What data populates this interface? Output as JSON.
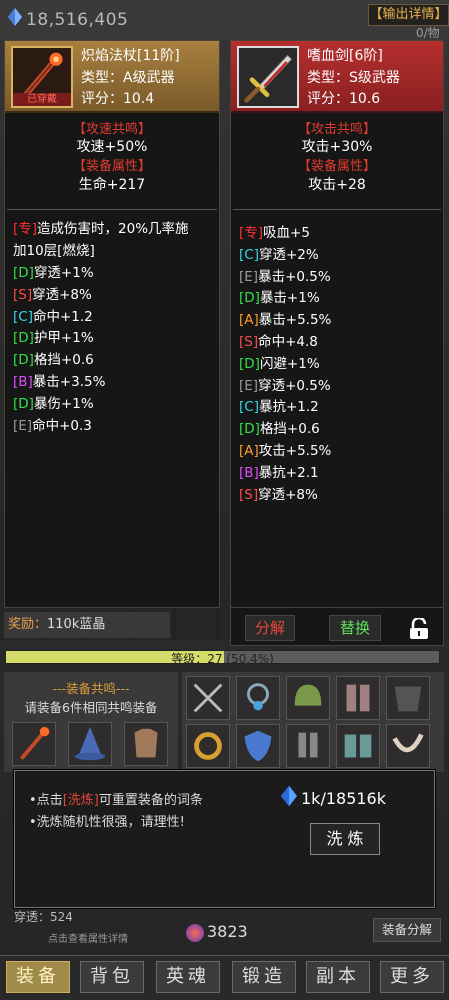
{
  "top": {
    "currency": "18,516,405",
    "output_btn": "【输出详情】",
    "output_sub": "0/物"
  },
  "left_item": {
    "name": "炽焰法杖[11阶]",
    "type": "类型：A级武器",
    "score": "评分：10.4",
    "worn": "已穿戴",
    "sec1_title": "【攻速共鸣】",
    "sec1_val": "攻速+50%",
    "sec2_title": "【装备属性】",
    "sec2_val": "生命+217",
    "special_line1": "造成伤害时，20%几率施",
    "special_line2": "加10层[燃烧]",
    "special_tag": "[专]",
    "affixes": [
      {
        "tag": "[D]",
        "grade": "D",
        "text": "穿透+1%"
      },
      {
        "tag": "[S]",
        "grade": "S",
        "text": "穿透+8%"
      },
      {
        "tag": "[C]",
        "grade": "C",
        "text": "命中+1.2"
      },
      {
        "tag": "[D]",
        "grade": "D",
        "text": "护甲+1%"
      },
      {
        "tag": "[D]",
        "grade": "D",
        "text": "格挡+0.6"
      },
      {
        "tag": "[B]",
        "grade": "B",
        "text": "暴击+3.5%"
      },
      {
        "tag": "[D]",
        "grade": "D",
        "text": "暴伤+1%"
      },
      {
        "tag": "[E]",
        "grade": "E",
        "text": "命中+0.3"
      }
    ]
  },
  "right_item": {
    "name": "嗜血剑[6阶]",
    "type": "类型：S级武器",
    "score": "评分：10.6",
    "sec1_title": "【攻击共鸣】",
    "sec1_val": "攻击+30%",
    "sec2_title": "【装备属性】",
    "sec2_val": "攻击+28",
    "affixes": [
      {
        "tag": "[专]",
        "grade": "zhuan",
        "text": "吸血+5"
      },
      {
        "tag": "[C]",
        "grade": "C",
        "text": "穿透+2%"
      },
      {
        "tag": "[E]",
        "grade": "E",
        "text": "暴击+0.5%"
      },
      {
        "tag": "[D]",
        "grade": "D",
        "text": "暴击+1%"
      },
      {
        "tag": "[A]",
        "grade": "A",
        "text": "暴击+5.5%"
      },
      {
        "tag": "[S]",
        "grade": "S",
        "text": "命中+4.8"
      },
      {
        "tag": "[D]",
        "grade": "D",
        "text": "闪避+1%"
      },
      {
        "tag": "[E]",
        "grade": "E",
        "text": "穿透+0.5%"
      },
      {
        "tag": "[C]",
        "grade": "C",
        "text": "暴抗+1.2"
      },
      {
        "tag": "[D]",
        "grade": "D",
        "text": "格挡+0.6"
      },
      {
        "tag": "[A]",
        "grade": "A",
        "text": "攻击+5.5%"
      },
      {
        "tag": "[B]",
        "grade": "B",
        "text": "暴抗+2.1"
      },
      {
        "tag": "[S]",
        "grade": "S",
        "text": "穿透+8%"
      }
    ],
    "btn_decompose": "分解",
    "btn_replace": "替换"
  },
  "reward": {
    "label": "奖励：",
    "value": "110k蓝晶"
  },
  "level": {
    "text": "等级：27 (50.4%)",
    "progress": 0.504
  },
  "resonance": {
    "title": "---装备共鸣---",
    "desc": "请装备6件相同共鸣装备"
  },
  "popup": {
    "line1_pre": "点击",
    "line1_hl": "[洗炼]",
    "line1_post": "可重置装备的词条",
    "line2": "洗炼随机性很强，请理性!",
    "cost": "1k/18516k",
    "wash_btn": "洗 炼"
  },
  "bottom": {
    "penetration": "穿透：524",
    "hint": "点击查看属性详情",
    "crystal": "3823",
    "decompose_btn": "装备分解"
  },
  "nav": [
    "装备",
    "背包",
    "英魂",
    "锻造",
    "副本",
    "更多"
  ],
  "colors": {
    "accent_gold": "#a8803f",
    "accent_red": "#b62f2f",
    "level_fill": "#d6dc6a"
  }
}
